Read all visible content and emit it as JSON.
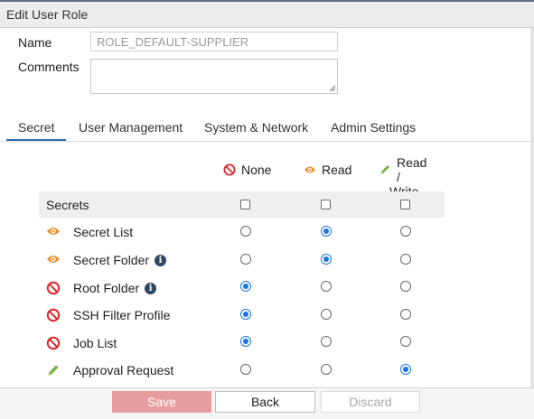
{
  "window": {
    "title": "Edit User Role"
  },
  "form": {
    "name_label": "Name",
    "name_value": "ROLE_DEFAULT-SUPPLIER",
    "comments_label": "Comments",
    "comments_value": ""
  },
  "tabs": [
    {
      "label": "Secret",
      "active": true
    },
    {
      "label": "User Management",
      "active": false
    },
    {
      "label": "System & Network",
      "active": false
    },
    {
      "label": "Admin Settings",
      "active": false
    }
  ],
  "columns": {
    "none": "None",
    "read": "Read",
    "rw_line1": "Read /",
    "rw_line2": "Write"
  },
  "group": {
    "label": "Secrets"
  },
  "rows": [
    {
      "label": "Secret List",
      "icon": "eye-icon",
      "info": false,
      "selected": "read"
    },
    {
      "label": "Secret Folder",
      "icon": "eye-icon",
      "info": true,
      "selected": "read"
    },
    {
      "label": "Root Folder",
      "icon": "no-access-icon",
      "info": true,
      "selected": "none"
    },
    {
      "label": "SSH Filter Profile",
      "icon": "no-access-icon",
      "info": false,
      "selected": "none"
    },
    {
      "label": "Job List",
      "icon": "no-access-icon",
      "info": false,
      "selected": "none"
    },
    {
      "label": "Approval Request",
      "icon": "pencil-icon",
      "info": false,
      "selected": "read_write"
    }
  ],
  "footer": {
    "save": "Save",
    "back": "Back",
    "discard": "Discard"
  },
  "colors": {
    "accent": "#1a73e8",
    "tab_underline": "#2f6da8",
    "none_icon": "#d9262b",
    "read_icon": "#e8912a",
    "write_icon": "#7cb342",
    "save_bg": "#e79d9d"
  }
}
